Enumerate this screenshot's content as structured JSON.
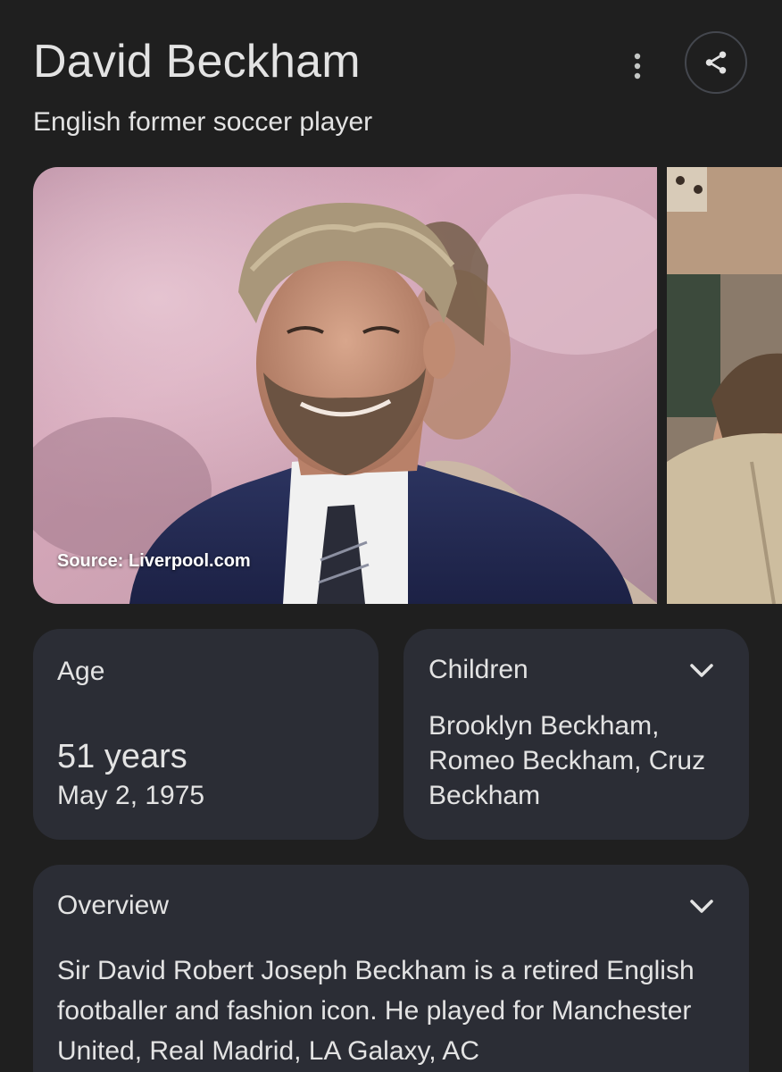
{
  "header": {
    "title": "David Beckham",
    "subtitle": "English former soccer player",
    "more_icon": "more-vert-icon",
    "share_icon": "share-icon"
  },
  "images": {
    "source": "Source: Liverpool.com"
  },
  "age": {
    "label": "Age",
    "value": "51 years",
    "date": "May 2, 1975"
  },
  "children": {
    "label": "Children",
    "value": "Brooklyn Beckham, Romeo Beckham, Cruz Beckham"
  },
  "overview": {
    "label": "Overview",
    "text": "Sir David Robert Joseph Beckham is a retired English footballer and fashion icon. He played for Manchester United, Real Madrid, LA Galaxy, AC"
  },
  "colors": {
    "background": "#1f1f1f",
    "card": "#2b2d35",
    "text": "#e3e3e3"
  }
}
